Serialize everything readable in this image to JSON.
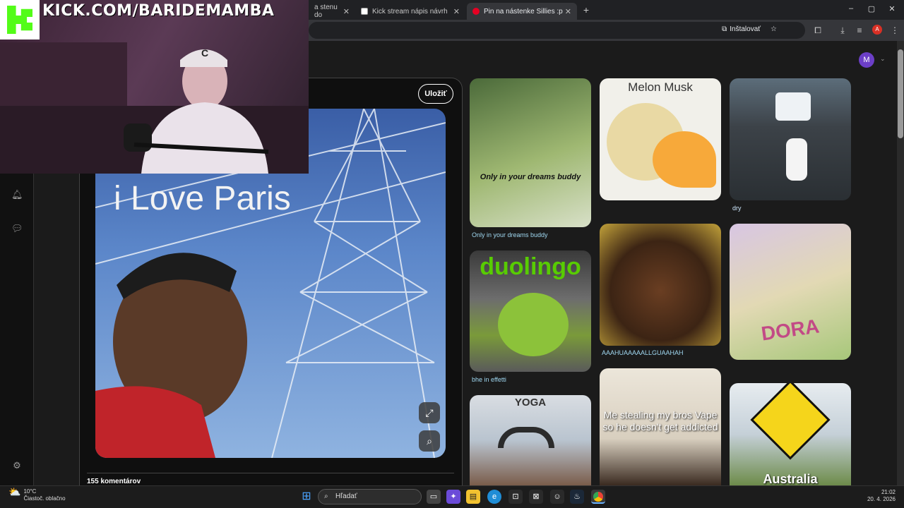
{
  "browser": {
    "tabs": [
      {
        "label": "a stenu do",
        "active": false
      },
      {
        "label": "Kick stream nápis návrh",
        "active": false
      },
      {
        "label": "Pin na nástenke Sillies :p",
        "active": true
      }
    ],
    "new_tab": "+",
    "install_label": "Inštalovať",
    "profile_initial": "A",
    "window_controls": [
      "–",
      "▢",
      "✕"
    ]
  },
  "stream": {
    "url_text": "KICK.COM/BARIDEMAMBA"
  },
  "pin": {
    "save_label": "Uložiť",
    "image_caption": "i Love Paris",
    "comments_label": "155 komentárov"
  },
  "user": {
    "avatar_initial": "M"
  },
  "grid": [
    {
      "overlay": "Only in your dreams buddy",
      "title": "Only in your dreams buddy"
    },
    {
      "overlay": "duolingo",
      "title": "bhe in effetti"
    },
    {
      "overlay": "YOGA",
      "title": ""
    },
    {
      "overlay": "Melon Musk",
      "title": ""
    },
    {
      "overlay": "",
      "title": "AAAHUAAAAALLGUAAHAH"
    },
    {
      "overlay": "Me stealing my bros Vape so he doesn't get addicted",
      "title": ""
    },
    {
      "overlay": "",
      "title": "dry"
    },
    {
      "overlay": "DORA",
      "title": ""
    },
    {
      "overlay": "Australia",
      "title": ""
    }
  ],
  "taskbar": {
    "weather_temp": "10°C",
    "weather_desc": "Čiastoč. oblačno",
    "search_placeholder": "Hľadať",
    "time": "21:02",
    "date": "20. 4. 2026"
  }
}
